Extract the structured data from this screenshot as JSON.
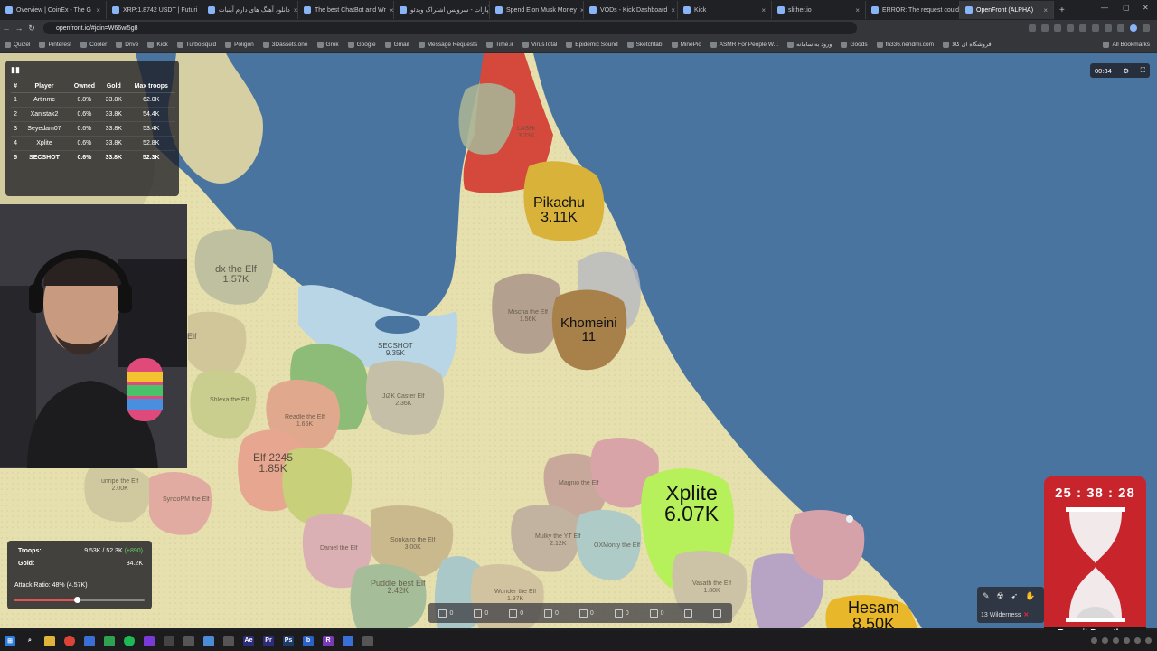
{
  "browser": {
    "tabs": [
      {
        "title": "Overview | CoinEx - The G"
      },
      {
        "title": "XRP:1.8742 USDT | Futuri"
      },
      {
        "title": "دانلود آهنگ های دارم آبنبات"
      },
      {
        "title": "The best ChatBot and Wr"
      },
      {
        "title": "آپارات - سرویس اشتراک ویدئو"
      },
      {
        "title": "Spend Elon Musk Money"
      },
      {
        "title": "VODs - Kick Dashboard"
      },
      {
        "title": "Kick"
      },
      {
        "title": "slither.io"
      },
      {
        "title": "ERROR: The request could"
      },
      {
        "title": "OpenFront (ALPHA)"
      }
    ],
    "new_tab": "+",
    "url": "openfront.io/#join=W66wi5g8",
    "bookmarks": [
      "Quizel",
      "Pinterest",
      "Cooler",
      "Drive",
      "Kick",
      "TurboSquid",
      "Poligon",
      "3Dassets.one",
      "Grok",
      "Google",
      "Gmail",
      "Message Requests",
      "Time.ir",
      "VirusTotal",
      "Epidemic Sound",
      "Sketchfab",
      "MinePic",
      "ASMR For People W...",
      "ورود به سامانه",
      "Goods",
      "fn336.nendmi.com",
      "فروشگاه ای کالا"
    ],
    "all_bookmarks": "All Bookmarks"
  },
  "leaderboard": {
    "headers": [
      "#",
      "Player",
      "Owned",
      "Gold",
      "Max troops"
    ],
    "rows": [
      {
        "rank": "1",
        "player": "Artinmc",
        "owned": "0.8%",
        "gold": "33.8K",
        "troops": "62.0K"
      },
      {
        "rank": "2",
        "player": "Xanistak2",
        "owned": "0.6%",
        "gold": "33.8K",
        "troops": "54.4K"
      },
      {
        "rank": "3",
        "player": "Seyedam07",
        "owned": "0.6%",
        "gold": "33.8K",
        "troops": "53.4K"
      },
      {
        "rank": "4",
        "player": "Xplite",
        "owned": "0.6%",
        "gold": "33.8K",
        "troops": "52.8K"
      },
      {
        "rank": "5",
        "player": "SECSHOT",
        "owned": "0.6%",
        "gold": "33.8K",
        "troops": "52.3K"
      }
    ]
  },
  "timer": {
    "value": "00:34"
  },
  "territories": {
    "pikachu": {
      "name": "Pikachu",
      "troops": "3.11K"
    },
    "khomeini": {
      "name": "Khomeini",
      "troops": "11"
    },
    "xplite": {
      "name": "Xplite",
      "troops": "6.07K"
    },
    "hesam": {
      "name": "Hesam",
      "troops": "8.50K"
    },
    "dx": {
      "name": "dx the Elf",
      "troops": "1.57K"
    },
    "elf2245": {
      "name": "Elf 2245",
      "troops": "1.85K"
    },
    "secshot": {
      "name": "SECSHOT",
      "troops": "9.35K"
    },
    "jizk": {
      "name": "JiZK Caster Elf",
      "troops": "2.36K"
    },
    "puddle": {
      "name": "Puddle best Elf",
      "troops": "2.42K"
    },
    "ljashr": {
      "name": "LASHr",
      "troops": "3.73K"
    },
    "mischa": {
      "name": "Mischa the Elf",
      "troops": "1.56K"
    },
    "readle": {
      "name": "Readle the Elf",
      "troops": "1.65K"
    },
    "sonkairo": {
      "name": "Sonkairo the Elf",
      "troops": "3.00K"
    },
    "mulky": {
      "name": "Mulky the YT Elf",
      "troops": "2.12K"
    },
    "wonder": {
      "name": "Wonder the Elf",
      "troops": "1.97K"
    },
    "vasath": {
      "name": "Vasath the Elf",
      "troops": "1.80K"
    },
    "unripe": {
      "name": "unripe the Elf",
      "troops": "2.00K"
    },
    "syncop": {
      "name": "SyncoPM the Elf",
      "troops": ""
    },
    "elfleft": {
      "name": "Elf",
      "troops": ""
    },
    "magnio": {
      "name": "Magnio the Elf",
      "troops": ""
    },
    "oxmonty": {
      "name": "OXMonty the Elf",
      "troops": ""
    },
    "daniel": {
      "name": "Daniel the Elf",
      "troops": ""
    },
    "shlexa": {
      "name": "Shlexa the Elf",
      "troops": ""
    }
  },
  "stats": {
    "troops_label": "Troops:",
    "troops_value": "9.53K / 52.3K",
    "troops_delta": "(+890)",
    "gold_label": "Gold:",
    "gold_value": "34.2K",
    "attack_label": "Attack Ratio: 48% (4.57K)",
    "attack_ratio": 0.48
  },
  "bottombar": {
    "items": [
      "0",
      "0",
      "0",
      "0",
      "0",
      "0",
      "0"
    ]
  },
  "actions": {
    "wilderness": "13 Wilderness"
  },
  "overlay": {
    "time": "25 : 38 : 28",
    "name": "Reymit Donathon"
  },
  "colors": {
    "ocean": "#4a74a0",
    "land": "#e6dfae",
    "pikachu": "#d9b23a",
    "khomeini": "#a8804a",
    "xplite": "#b6f05a",
    "hesam": "#e8b82a",
    "red": "#d5483c",
    "secshot": "#b8d6e6"
  }
}
